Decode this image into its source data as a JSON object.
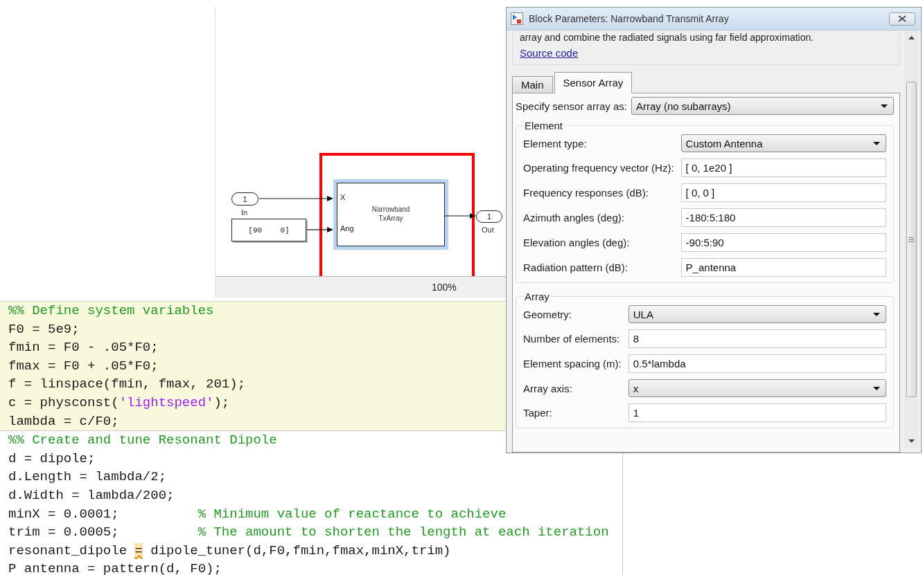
{
  "model_canvas": {
    "blocks": [
      {
        "kind": "inport",
        "number": "1",
        "label": "In"
      },
      {
        "kind": "constant",
        "value": "[90    0]"
      },
      {
        "kind": "subsystem",
        "name_lines": [
          "Narrowband",
          "TxArray"
        ],
        "ports": [
          "X",
          "Ang"
        ],
        "selected": true,
        "highlighted": true
      },
      {
        "kind": "outport",
        "number": "1",
        "label": "Out"
      }
    ],
    "zoom": "100%"
  },
  "code_editor": {
    "cells": [
      {
        "highlighted": true,
        "lines": [
          [
            {
              "kind": "comment",
              "text": "%% Define system variables"
            }
          ],
          [
            {
              "kind": "code",
              "text": "F0 = 5e9;"
            }
          ],
          [
            {
              "kind": "code",
              "text": "fmin = F0 - .05*F0;"
            }
          ],
          [
            {
              "kind": "code",
              "text": "fmax = F0 + .05*F0;"
            }
          ],
          [
            {
              "kind": "code",
              "text": "f = linspace(fmin, fmax, 201);"
            }
          ],
          [
            {
              "kind": "code",
              "text": "c = physconst("
            },
            {
              "kind": "string",
              "text": "'lightspeed'"
            },
            {
              "kind": "code",
              "text": ");"
            }
          ],
          [
            {
              "kind": "code",
              "text": "lambda = c/F0;"
            }
          ]
        ]
      },
      {
        "highlighted": false,
        "lines": [
          [
            {
              "kind": "comment",
              "text": "%% Create and tune Resonant Dipole"
            }
          ],
          [
            {
              "kind": "code",
              "text": "d = dipole;"
            }
          ],
          [
            {
              "kind": "code",
              "text": "d.Length = lambda/2;"
            }
          ],
          [
            {
              "kind": "code",
              "text": "d.Width = lambda/200;"
            }
          ],
          [
            {
              "kind": "code",
              "text": "minX = 0.0001;          "
            },
            {
              "kind": "comment",
              "text": "% Minimum value of reactance to achieve"
            }
          ],
          [
            {
              "kind": "code",
              "text": "trim = 0.0005;          "
            },
            {
              "kind": "comment",
              "text": "% The amount to shorten the length at each iteration"
            }
          ],
          [
            {
              "kind": "code",
              "text": "resonant_dipole "
            },
            {
              "kind": "warning",
              "text": "="
            },
            {
              "kind": "code",
              "text": " dipole_tuner(d,F0,fmin,fmax,minX,trim)"
            }
          ],
          [
            {
              "kind": "code",
              "text": "P antenna = pattern(d, F0);"
            }
          ]
        ]
      }
    ]
  },
  "dialog": {
    "title": "Block Parameters: Narrowband Transmit Array",
    "description": "array and combine the radiated signals using far field approximation.",
    "link": "Source code",
    "tabs": [
      {
        "label": "Main",
        "selected": false
      },
      {
        "label": "Sensor Array",
        "selected": true
      }
    ],
    "specify": {
      "label": "Specify sensor array as:",
      "value": "Array (no subarrays)"
    },
    "groups": [
      {
        "title": "Element",
        "fields": [
          {
            "kind": "select",
            "label": "Element type:",
            "value": "Custom Antenna"
          },
          {
            "kind": "text",
            "label": "Operating frequency vector (Hz):",
            "value": "[ 0, 1e20 ]"
          },
          {
            "kind": "text",
            "label": "Frequency responses (dB):",
            "value": "[ 0, 0 ]"
          },
          {
            "kind": "text",
            "label": "Azimuth angles (deg):",
            "value": "-180:5:180"
          },
          {
            "kind": "text",
            "label": "Elevation angles (deg):",
            "value": "-90:5:90"
          },
          {
            "kind": "text",
            "label": "Radiation pattern (dB):",
            "value": "P_antenna"
          }
        ]
      },
      {
        "title": "Array",
        "fields": [
          {
            "kind": "select",
            "label": "Geometry:",
            "value": "ULA"
          },
          {
            "kind": "text",
            "label": "Number of elements:",
            "value": "8"
          },
          {
            "kind": "text",
            "label": "Element spacing (m):",
            "value": "0.5*lambda"
          },
          {
            "kind": "select",
            "label": "Array axis:",
            "value": "x"
          },
          {
            "kind": "text",
            "label": "Taper:",
            "value": "1"
          }
        ]
      }
    ]
  }
}
